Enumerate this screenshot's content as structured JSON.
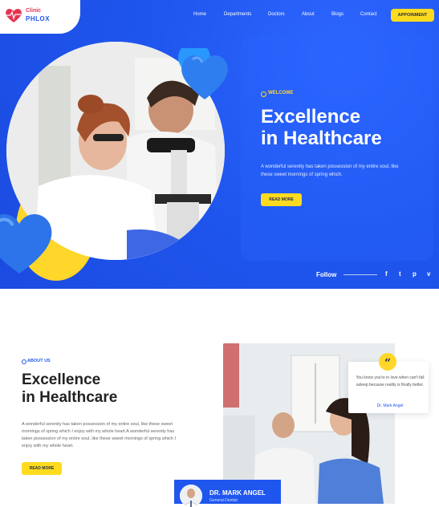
{
  "header": {
    "brand_small": "Clinic",
    "brand_name": "PHLOX",
    "nav": [
      "Home",
      "Departments",
      "Doctors",
      "About",
      "Blogs",
      "Contact"
    ],
    "appointment_label": "APPOINMENT"
  },
  "hero": {
    "eyebrow": "WELCOME",
    "title_line1": "Excellence",
    "title_line2": "in Healthcare",
    "text": "A wonderful serenity has taken possession of my entire soul, like these sweet mornings of spring which.",
    "button_label": "READ MORE",
    "follow_label": "Follow",
    "social_icons": [
      "facebook-icon",
      "twitter-icon",
      "pinterest-icon",
      "vimeo-icon"
    ],
    "social_glyphs": [
      "f",
      "t",
      "p",
      "v"
    ]
  },
  "about": {
    "eyebrow": "ABOUT US",
    "title_line1": "Excellence",
    "title_line2": "in Healthcare",
    "text": "A wonderful serenity has taken possession of my entire soul, like these sweet mornings of spring which I enjoy with my whole heart.A wonderful serenity has taken possession of my entire soul, like these sweet mornings of spring which I enjoy with my whole heart.",
    "button_label": "READ MORE"
  },
  "quote": {
    "text": "You know you're in love when can't fall asleep because reality is finally better.",
    "author": "Dr. Mark Angel"
  },
  "doctor": {
    "name": "DR. MARK ANGEL",
    "role": "General Dentist"
  },
  "colors": {
    "primary": "#1f56ee",
    "accent": "#ffdb1f",
    "heart": "#e53350"
  }
}
